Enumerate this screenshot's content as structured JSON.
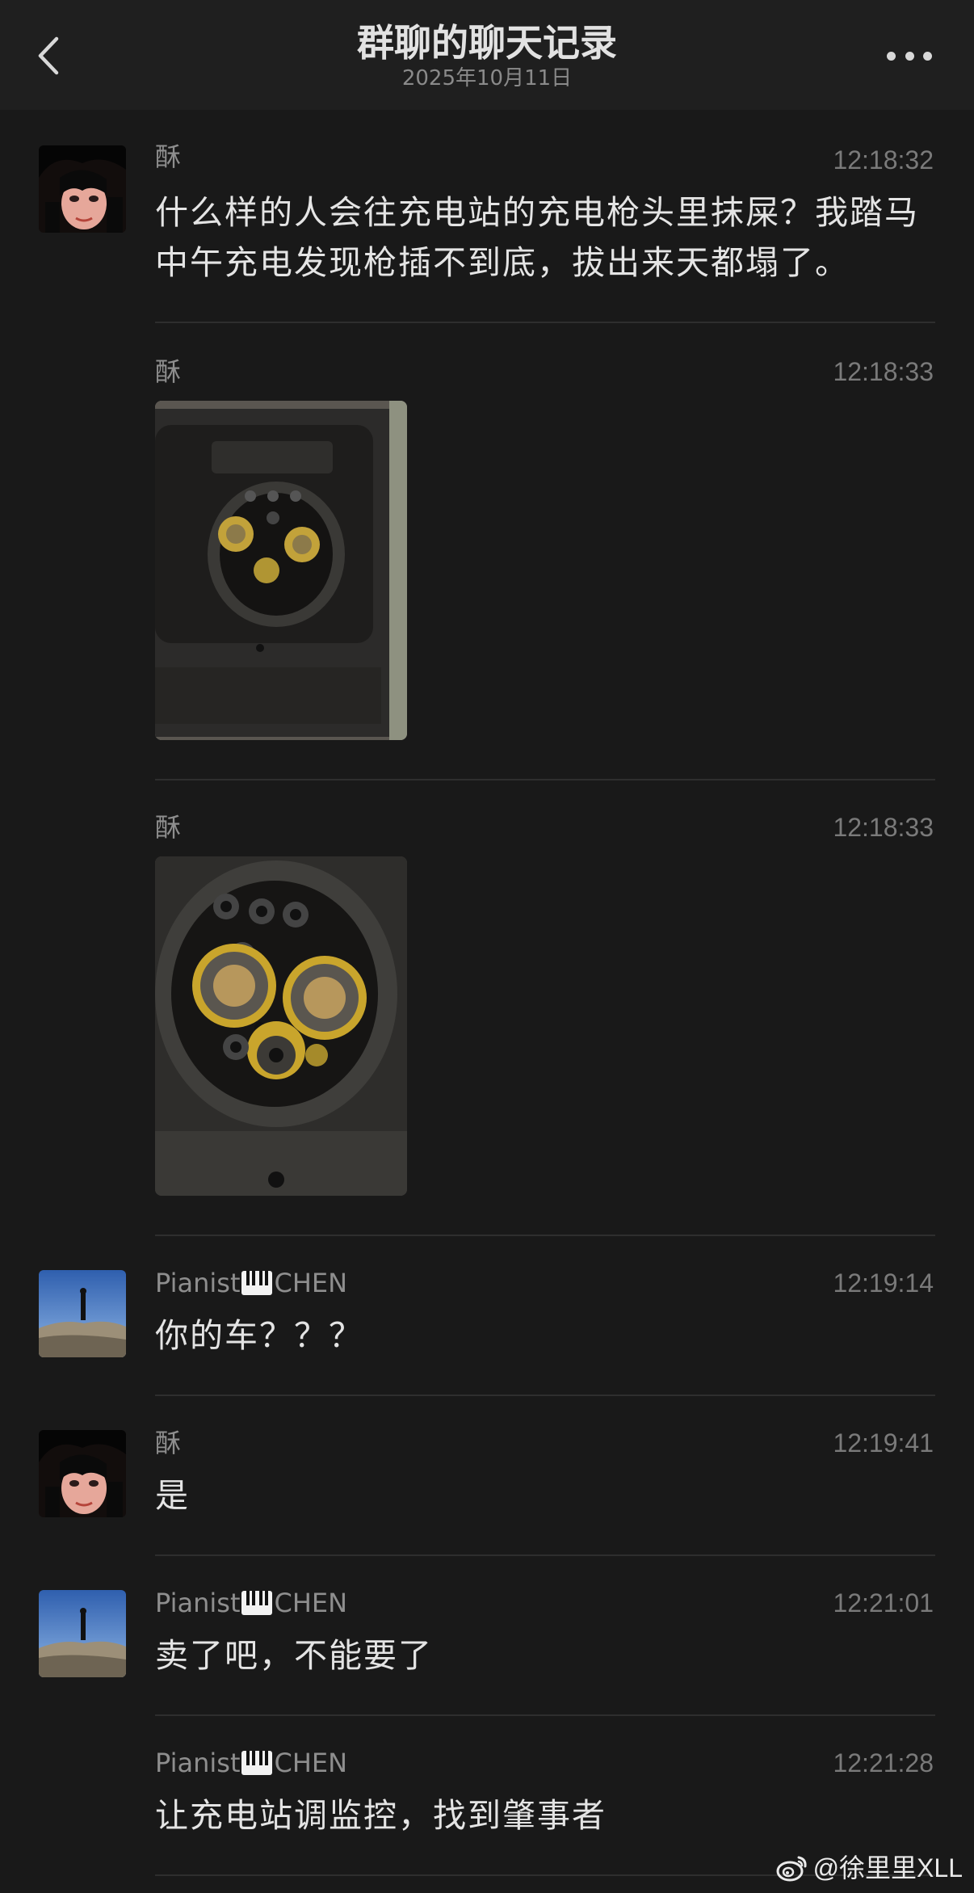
{
  "header": {
    "title": "群聊的聊天记录",
    "date": "2025年10月11日"
  },
  "messages": [
    {
      "sender": "酥",
      "time": "12:18:32",
      "text": "什么样的人会往充电站的充电枪头里抹屎？我踏马中午充电发现枪插不到底，拔出来天都塌了。"
    },
    {
      "sender": "酥",
      "time": "12:18:33",
      "image": "charging-port-photo"
    },
    {
      "sender": "酥",
      "time": "12:18:33",
      "image": "charging-port-closeup-photo"
    },
    {
      "sender": "Pianist",
      "sender_suffix": "CHEN",
      "sender_emoji": "piano-icon",
      "time": "12:19:14",
      "text": "你的车？？？"
    },
    {
      "sender": "酥",
      "time": "12:19:41",
      "text": "是"
    },
    {
      "sender": "Pianist",
      "sender_suffix": "CHEN",
      "sender_emoji": "piano-icon",
      "time": "12:21:01",
      "text": "卖了吧，不能要了"
    },
    {
      "sender": "Pianist",
      "sender_suffix": "CHEN",
      "sender_emoji": "piano-icon",
      "time": "12:21:28",
      "text": "让充电站调监控，找到肇事者"
    }
  ],
  "watermark": {
    "text": "@徐里里XLL",
    "icon": "weibo-icon"
  },
  "colors": {
    "background": "#191919",
    "header": "#1f1f1f",
    "text": "#e4e4e4",
    "meta": "#8e8e8e"
  }
}
